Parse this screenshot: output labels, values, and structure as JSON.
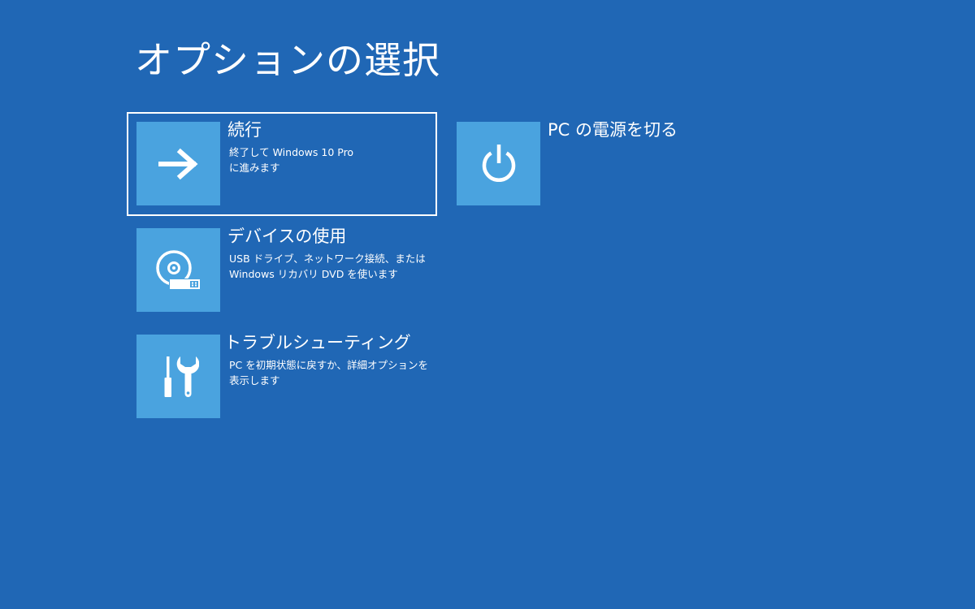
{
  "screen": {
    "title": "オプションの選択",
    "background": "#2067b5",
    "tile_color": "#4aa3df"
  },
  "options": [
    {
      "title": "続行",
      "desc_line1": "終了して Windows 10 Pro",
      "desc_line2": "に進みます",
      "icon": "arrow-right-icon",
      "selected": true
    },
    {
      "title": "PC の電源を切る",
      "desc_line1": "",
      "desc_line2": "",
      "icon": "power-icon",
      "selected": false
    },
    {
      "title": "デバイスの使用",
      "desc_line1": "USB ドライブ、ネットワーク接続、または",
      "desc_line2": "Windows リカバリ DVD を使います",
      "icon": "disc-usb-icon",
      "selected": false
    },
    {
      "title": "トラブルシューティング",
      "desc_line1": "PC を初期状態に戻すか、詳細オプションを",
      "desc_line2": "表示します",
      "icon": "tools-icon",
      "selected": false
    }
  ]
}
